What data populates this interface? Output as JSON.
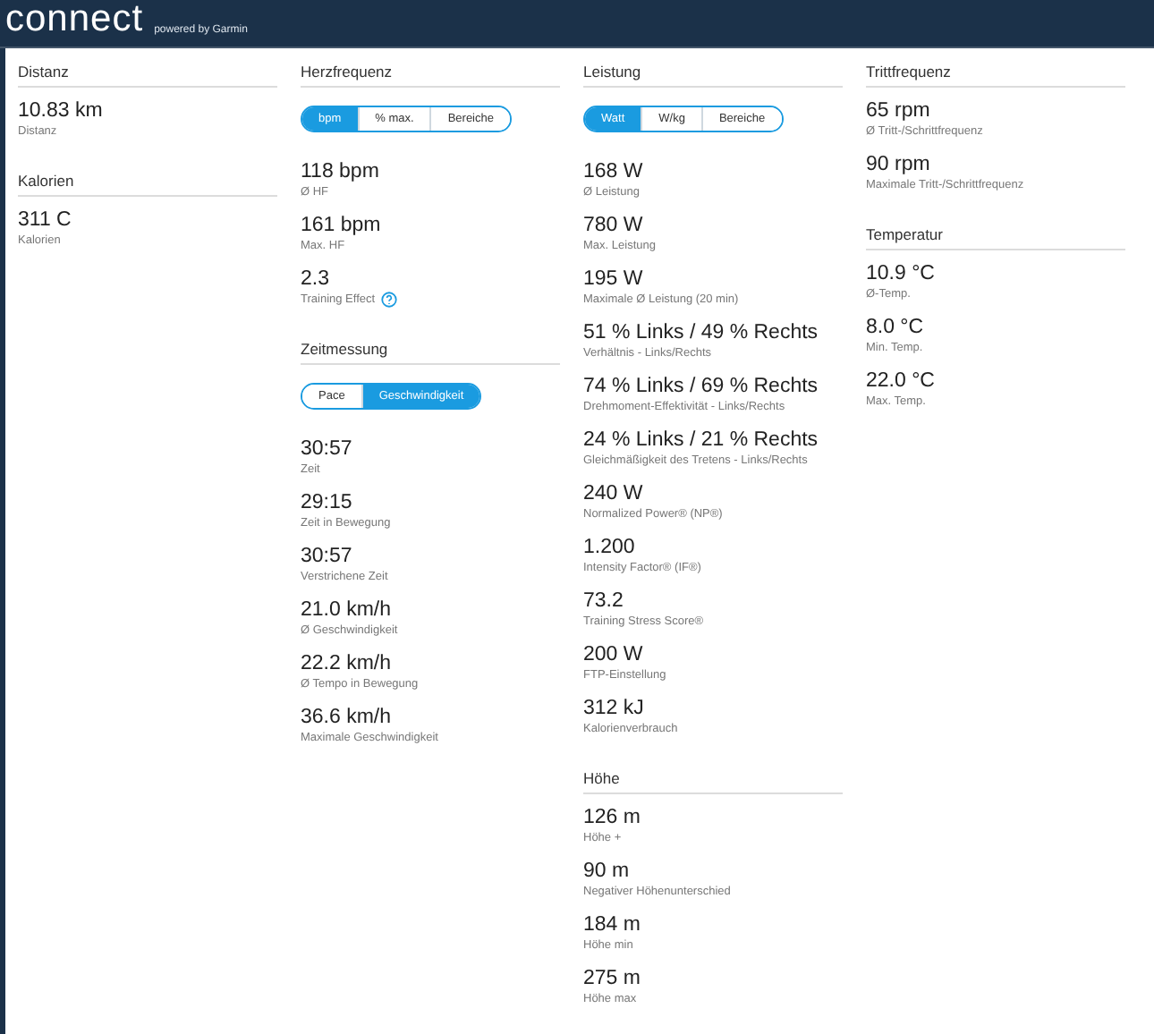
{
  "header": {
    "logo": "connect",
    "tagline": "powered by Garmin"
  },
  "columns": [
    {
      "sections": [
        {
          "title": "Distanz",
          "stats": [
            {
              "value": "10.83 km",
              "label": "Distanz",
              "help": false
            }
          ]
        },
        {
          "title": "Kalorien",
          "stats": [
            {
              "value": "311 C",
              "label": "Kalorien",
              "help": false
            }
          ]
        }
      ]
    },
    {
      "sections": [
        {
          "title": "Herzfrequenz",
          "toggle": [
            {
              "label": "bpm",
              "selected": true
            },
            {
              "label": "% max.",
              "selected": false
            },
            {
              "label": "Bereiche",
              "selected": false
            }
          ],
          "stats": [
            {
              "value": "118 bpm",
              "label": "Ø HF",
              "help": false
            },
            {
              "value": "161 bpm",
              "label": "Max. HF",
              "help": false
            },
            {
              "value": "2.3",
              "label": "Training Effect",
              "help": true
            }
          ]
        },
        {
          "title": "Zeitmessung",
          "toggle": [
            {
              "label": "Pace",
              "selected": false
            },
            {
              "label": "Geschwindigkeit",
              "selected": true
            }
          ],
          "stats": [
            {
              "value": "30:57",
              "label": "Zeit",
              "help": false
            },
            {
              "value": "29:15",
              "label": "Zeit in Bewegung",
              "help": false
            },
            {
              "value": "30:57",
              "label": "Verstrichene Zeit",
              "help": false
            },
            {
              "value": "21.0 km/h",
              "label": "Ø Geschwindigkeit",
              "help": false
            },
            {
              "value": "22.2 km/h",
              "label": "Ø Tempo in Bewegung",
              "help": false
            },
            {
              "value": "36.6 km/h",
              "label": "Maximale Geschwindigkeit",
              "help": false
            }
          ]
        }
      ]
    },
    {
      "sections": [
        {
          "title": "Leistung",
          "toggle": [
            {
              "label": "Watt",
              "selected": true
            },
            {
              "label": "W/kg",
              "selected": false
            },
            {
              "label": "Bereiche",
              "selected": false
            }
          ],
          "stats": [
            {
              "value": "168 W",
              "label": "Ø Leistung",
              "help": false
            },
            {
              "value": "780 W",
              "label": "Max. Leistung",
              "help": false
            },
            {
              "value": "195 W",
              "label": "Maximale Ø Leistung (20 min)",
              "help": false
            },
            {
              "value": "51 % Links / 49 % Rechts",
              "label": "Verhältnis - Links/Rechts",
              "help": false
            },
            {
              "value": "74 % Links / 69 % Rechts",
              "label": "Drehmoment-Effektivität - Links/Rechts",
              "help": false
            },
            {
              "value": "24 % Links / 21 % Rechts",
              "label": "Gleichmäßigkeit des Tretens - Links/Rechts",
              "help": false
            },
            {
              "value": "240 W",
              "label": "Normalized Power® (NP®)",
              "help": false
            },
            {
              "value": "1.200",
              "label": "Intensity Factor® (IF®)",
              "help": false
            },
            {
              "value": "73.2",
              "label": "Training Stress Score®",
              "help": false
            },
            {
              "value": "200 W",
              "label": "FTP-Einstellung",
              "help": false
            },
            {
              "value": "312 kJ",
              "label": "Kalorienverbrauch",
              "help": false
            }
          ]
        },
        {
          "title": "Höhe",
          "stats": [
            {
              "value": "126 m",
              "label": "Höhe +",
              "help": false
            },
            {
              "value": "90 m",
              "label": "Negativer Höhenunterschied",
              "help": false
            },
            {
              "value": "184 m",
              "label": "Höhe min",
              "help": false
            },
            {
              "value": "275 m",
              "label": "Höhe max",
              "help": false
            }
          ]
        }
      ]
    },
    {
      "sections": [
        {
          "title": "Trittfrequenz",
          "stats": [
            {
              "value": "65 rpm",
              "label": "Ø Tritt-/Schrittfrequenz",
              "help": false
            },
            {
              "value": "90 rpm",
              "label": "Maximale Tritt-/Schrittfrequenz",
              "help": false
            }
          ]
        },
        {
          "title": "Temperatur",
          "stats": [
            {
              "value": "10.9 °C",
              "label": "Ø-Temp.",
              "help": false
            },
            {
              "value": "8.0 °C",
              "label": "Min. Temp.",
              "help": false
            },
            {
              "value": "22.0 °C",
              "label": "Max. Temp.",
              "help": false
            }
          ]
        }
      ]
    }
  ]
}
